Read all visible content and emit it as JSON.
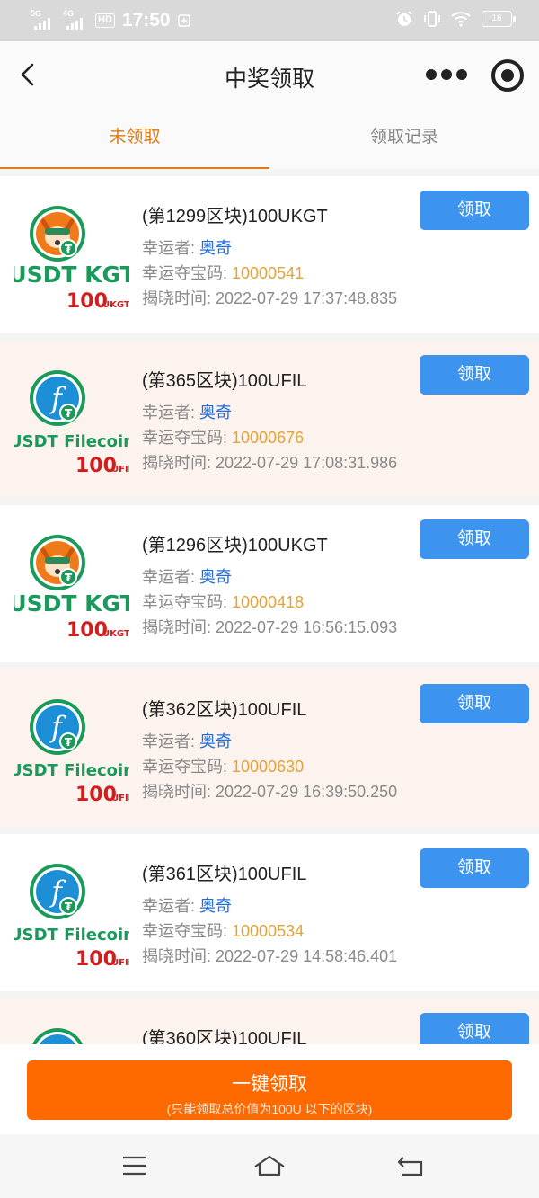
{
  "status_bar": {
    "sim1": "5G",
    "sim2": "4G",
    "hd": "HD",
    "time": "17:50",
    "battery": "16"
  },
  "header": {
    "title": "中奖领取"
  },
  "tabs": [
    {
      "label": "未领取",
      "active": true
    },
    {
      "label": "领取记录",
      "active": false
    }
  ],
  "labels": {
    "winner": "幸运者: ",
    "code": "幸运夺宝码: ",
    "time": "揭晓时间: ",
    "claim": "领取"
  },
  "logos": {
    "kgt": {
      "text": "USDT KGT",
      "amount": "100",
      "unit": "UKGT"
    },
    "fil": {
      "text": "USDT Filecoin",
      "amount": "100",
      "unit": "UFIL"
    }
  },
  "items": [
    {
      "name": "(第1299区块)100UKGT",
      "winner": "奥奇",
      "code": "10000541",
      "time": "2022-07-29 17:37:48.835"
    },
    {
      "name": "(第365区块)100UFIL",
      "winner": "奥奇",
      "code": "10000676",
      "time": "2022-07-29 17:08:31.986"
    },
    {
      "name": "(第1296区块)100UKGT",
      "winner": "奥奇",
      "code": "10000418",
      "time": "2022-07-29 16:56:15.093"
    },
    {
      "name": "(第362区块)100UFIL",
      "winner": "奥奇",
      "code": "10000630",
      "time": "2022-07-29 16:39:50.250"
    },
    {
      "name": "(第361区块)100UFIL",
      "winner": "奥奇",
      "code": "10000534",
      "time": "2022-07-29 14:58:46.401"
    },
    {
      "name": "(第360区块)100UFIL"
    }
  ],
  "bottom": {
    "button_label": "一键领取",
    "button_note": "(只能领取总价值为100U 以下的区块)"
  },
  "colors": {
    "accent_orange": "#ff6a00",
    "tab_active": "#e07a12",
    "claim_blue": "#3d94ee",
    "winner_blue": "#1f6fe0",
    "code_orange": "#e3a23a",
    "logo_green": "#1a9a5a",
    "logo_red": "#d21d1d"
  }
}
